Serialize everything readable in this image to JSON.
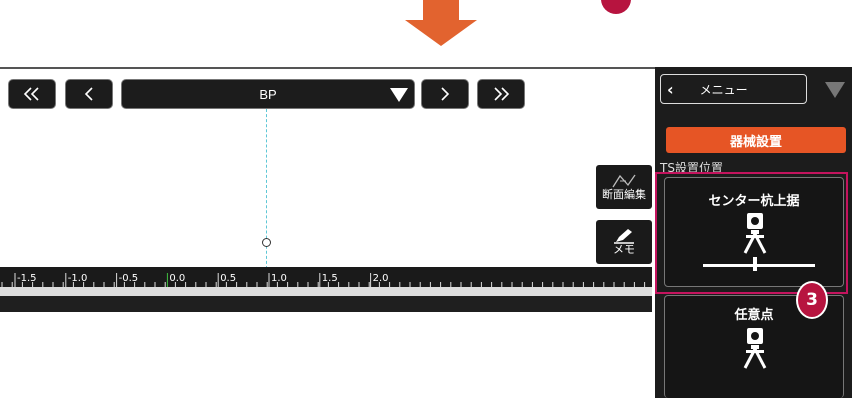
{
  "nav": {
    "first_label": "<<",
    "prev_label": "<",
    "station_select": {
      "value": "BP"
    },
    "next_label": ">",
    "last_label": ">>"
  },
  "side_buttons": {
    "section_edit_label": "断面編集",
    "memo_label": "メモ"
  },
  "ruler": {
    "labels": [
      "-1.5",
      "-1.0",
      "-0.5",
      "0.0",
      "0.5",
      "1.0",
      "1.5",
      "2.0"
    ]
  },
  "panel": {
    "menu_label": "メニュー",
    "instrument_setup_label": "器械設置",
    "section_label": "TS設置位置",
    "options": [
      {
        "label": "センター杭上据"
      },
      {
        "label": "任意点"
      }
    ]
  },
  "annotation": {
    "step": "3"
  },
  "colors": {
    "accent_orange": "#e65525",
    "highlight": "#c4145e",
    "badge": "#b7143f",
    "centerline": "#5ec7d6"
  },
  "icons": [
    "chevron-double-left-icon",
    "chevron-left-icon",
    "triangle-down-icon",
    "chevron-right-icon",
    "chevron-double-right-icon",
    "section-edit-icon",
    "memo-pen-icon",
    "total-station-icon"
  ]
}
